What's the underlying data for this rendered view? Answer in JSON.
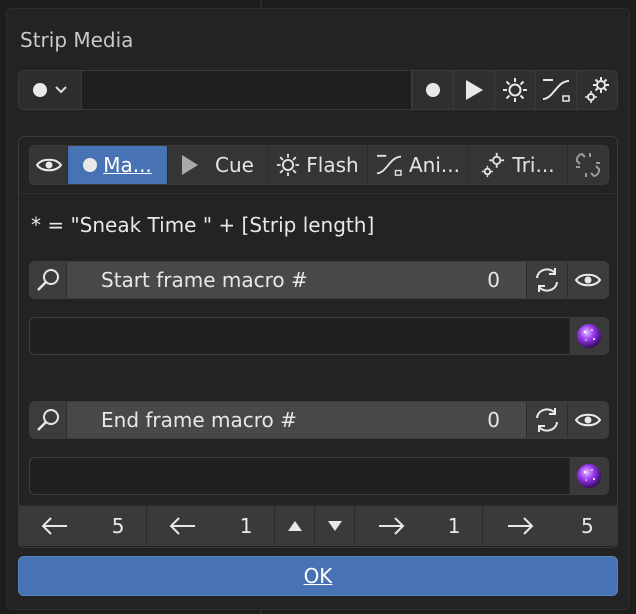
{
  "dialog": {
    "title": "Strip Media"
  },
  "toolbar": {
    "dropdown_icon": "record-dot-icon",
    "input_value": "",
    "buttons": [
      "record-dot-icon",
      "play-icon",
      "light-icon",
      "curve-icon",
      "gears-icon"
    ]
  },
  "tabs": [
    {
      "label": "Ma...",
      "icon": "record-dot-icon",
      "active": true
    },
    {
      "label": "Cue",
      "icon": "play-icon",
      "active": false
    },
    {
      "label": "Flash",
      "icon": "light-icon",
      "active": false
    },
    {
      "label": "Ani...",
      "icon": "curve-icon",
      "active": false
    },
    {
      "label": "Tri...",
      "icon": "gears-icon",
      "active": false
    }
  ],
  "formula": "* = \"Sneak Time \" + [Strip length]",
  "start_macro": {
    "label": "Start frame macro #",
    "value": "0",
    "text": ""
  },
  "end_macro": {
    "label": "End frame macro #",
    "value": "0",
    "text": ""
  },
  "nav": {
    "back_big": "5",
    "back_small": "1",
    "fwd_small": "1",
    "fwd_big": "5"
  },
  "ok_label": "OK",
  "colors": {
    "accent": "#4772b3",
    "panel": "#232323",
    "field": "#484848"
  }
}
